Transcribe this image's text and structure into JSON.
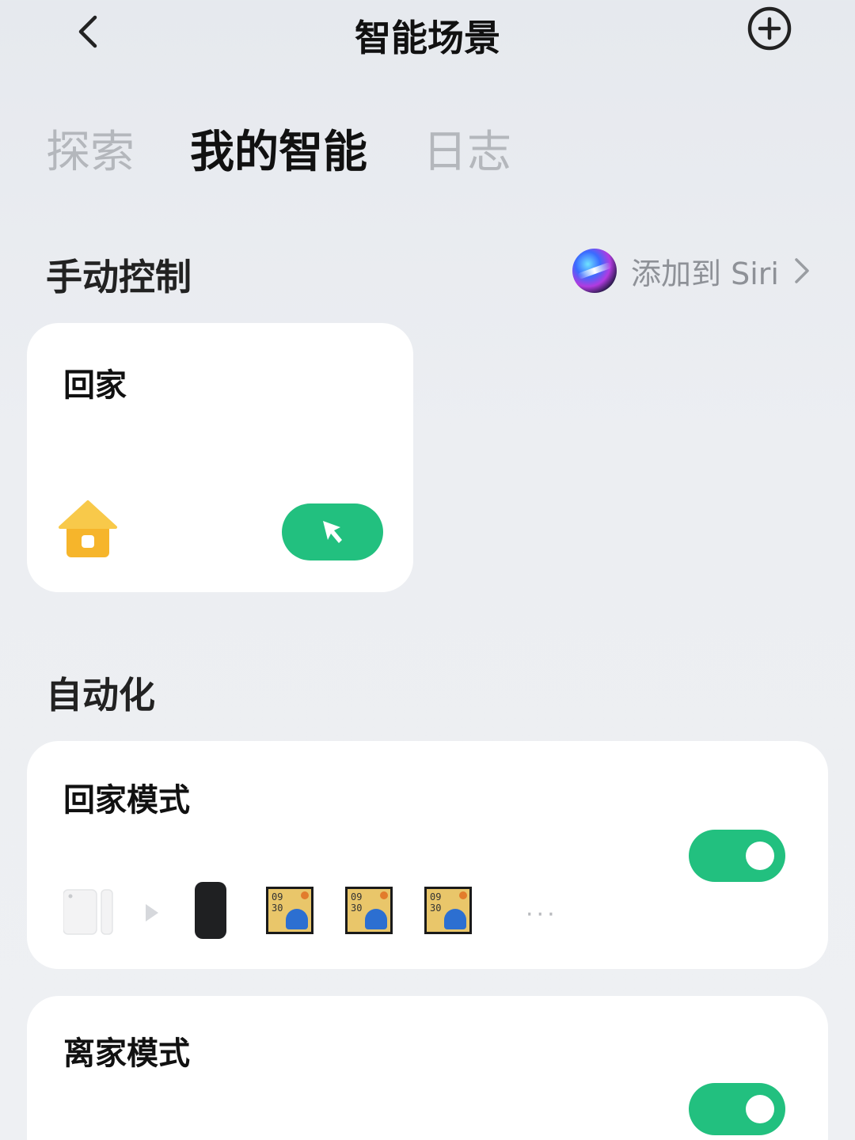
{
  "header": {
    "title": "智能场景"
  },
  "tabs": [
    {
      "label": "探索",
      "active": false
    },
    {
      "label": "我的智能",
      "active": true
    },
    {
      "label": "日志",
      "active": false
    }
  ],
  "manual": {
    "section_title": "手动控制",
    "siri_label": "添加到 Siri",
    "scene": {
      "title": "回家",
      "icon": "house-icon"
    }
  },
  "automation": {
    "section_title": "自动化",
    "items": [
      {
        "title": "回家模式",
        "enabled": true,
        "devices": [
          {
            "icon": "door-sensor-icon"
          },
          {
            "icon": "speaker-icon"
          },
          {
            "icon": "photo-frame-icon",
            "text_line1": "09",
            "text_line2": "30"
          },
          {
            "icon": "photo-frame-icon",
            "text_line1": "09",
            "text_line2": "30"
          },
          {
            "icon": "photo-frame-icon",
            "text_line1": "09",
            "text_line2": "30"
          }
        ],
        "more": "···"
      },
      {
        "title": "离家模式",
        "enabled": true
      }
    ]
  },
  "colors": {
    "accent_green": "#22c07f",
    "house_yellow": "#f6b52b",
    "tab_inactive": "#b4b7bc"
  }
}
